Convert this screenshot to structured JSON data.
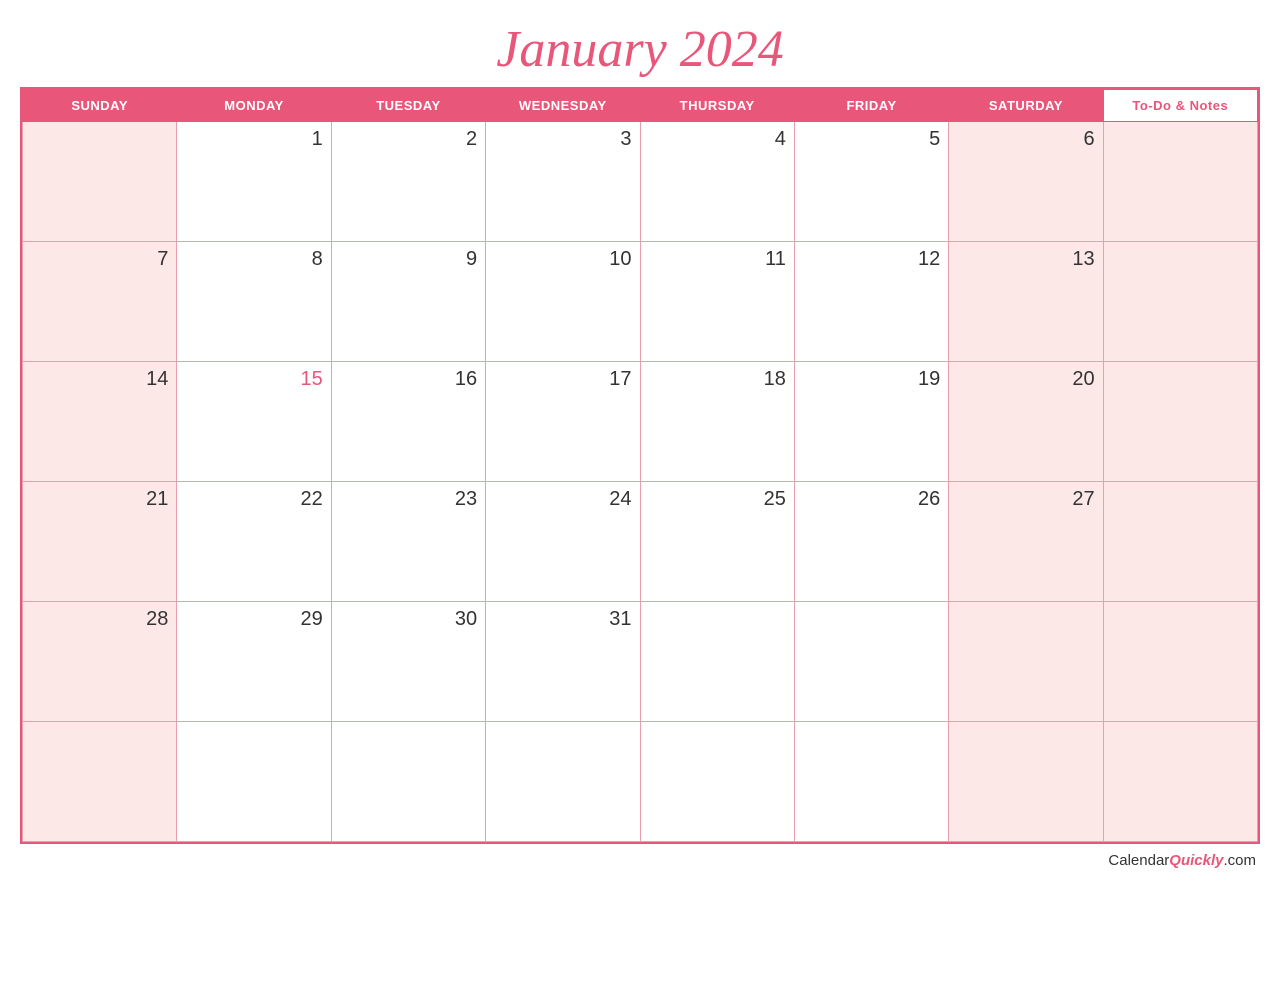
{
  "title": "January 2024",
  "days_of_week": [
    "SUNDAY",
    "MONDAY",
    "TUESDAY",
    "WEDNESDAY",
    "THURSDAY",
    "FRIDAY",
    "SATURDAY"
  ],
  "notes_header": "To-Do & Notes",
  "weeks": [
    [
      {
        "day": "",
        "weekend": true
      },
      {
        "day": "1",
        "weekend": false
      },
      {
        "day": "2",
        "weekend": false
      },
      {
        "day": "3",
        "weekend": false
      },
      {
        "day": "4",
        "weekend": false
      },
      {
        "day": "5",
        "weekend": false
      },
      {
        "day": "6",
        "weekend": true
      },
      {
        "notes": true
      }
    ],
    [
      {
        "day": "7",
        "weekend": true
      },
      {
        "day": "8",
        "weekend": false
      },
      {
        "day": "9",
        "weekend": false
      },
      {
        "day": "10",
        "weekend": false
      },
      {
        "day": "11",
        "weekend": false
      },
      {
        "day": "12",
        "weekend": false
      },
      {
        "day": "13",
        "weekend": true
      },
      {
        "notes": true
      }
    ],
    [
      {
        "day": "14",
        "weekend": true
      },
      {
        "day": "15",
        "weekend": false,
        "red": true
      },
      {
        "day": "16",
        "weekend": false
      },
      {
        "day": "17",
        "weekend": false
      },
      {
        "day": "18",
        "weekend": false
      },
      {
        "day": "19",
        "weekend": false
      },
      {
        "day": "20",
        "weekend": true
      },
      {
        "notes": true
      }
    ],
    [
      {
        "day": "21",
        "weekend": true
      },
      {
        "day": "22",
        "weekend": false
      },
      {
        "day": "23",
        "weekend": false
      },
      {
        "day": "24",
        "weekend": false
      },
      {
        "day": "25",
        "weekend": false
      },
      {
        "day": "26",
        "weekend": false
      },
      {
        "day": "27",
        "weekend": true
      },
      {
        "notes": true
      }
    ],
    [
      {
        "day": "28",
        "weekend": true
      },
      {
        "day": "29",
        "weekend": false
      },
      {
        "day": "30",
        "weekend": false
      },
      {
        "day": "31",
        "weekend": false
      },
      {
        "day": "",
        "weekend": false
      },
      {
        "day": "",
        "weekend": false
      },
      {
        "day": "",
        "weekend": true
      },
      {
        "notes": true
      }
    ],
    [
      {
        "day": "",
        "weekend": true
      },
      {
        "day": "",
        "weekend": false
      },
      {
        "day": "",
        "weekend": false
      },
      {
        "day": "",
        "weekend": false
      },
      {
        "day": "",
        "weekend": false
      },
      {
        "day": "",
        "weekend": false
      },
      {
        "day": "",
        "weekend": true
      },
      {
        "notes": true
      }
    ]
  ],
  "footer": {
    "calendar": "Calendar",
    "quickly": "Quickly",
    "com": ".com"
  }
}
